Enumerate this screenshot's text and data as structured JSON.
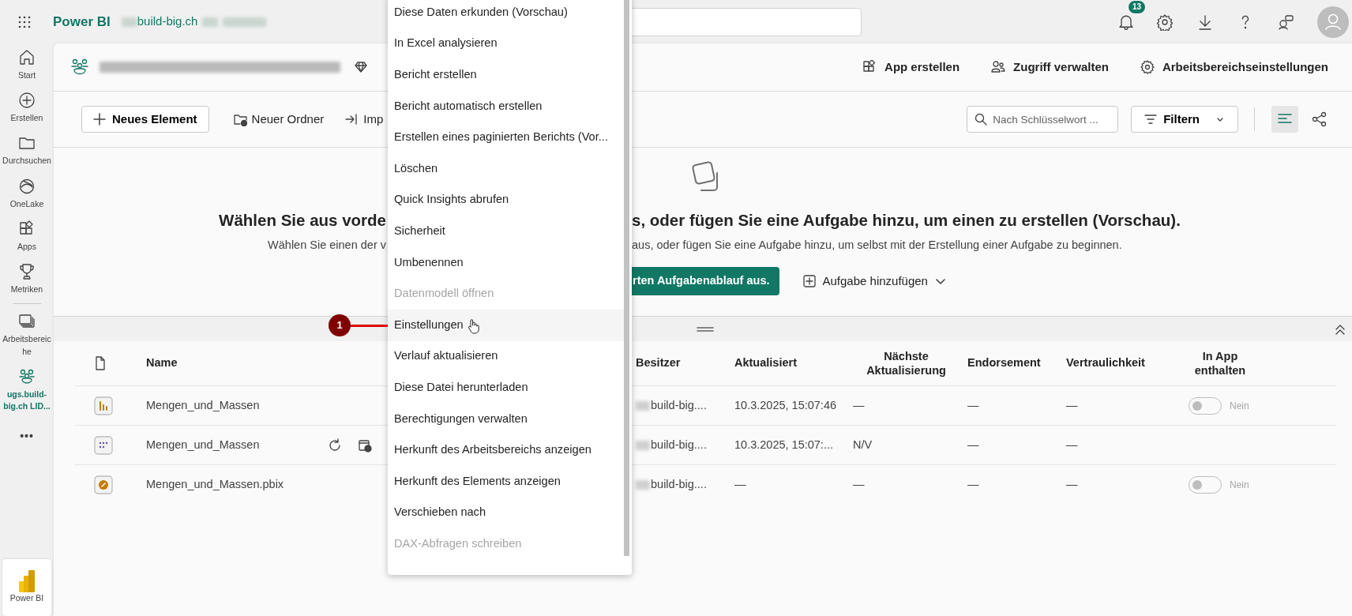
{
  "topbar": {
    "app_name": "Power BI",
    "tenant": "build-big.ch",
    "notification_count": "13"
  },
  "sidebar": {
    "items": [
      {
        "label": "Start",
        "kind": "home",
        "selected": false
      },
      {
        "label": "Erstellen",
        "kind": "create",
        "selected": false
      },
      {
        "label": "Durchsuchen",
        "kind": "browse",
        "selected": false
      },
      {
        "label": "OneLake",
        "kind": "onelake",
        "selected": false
      },
      {
        "label": "Apps",
        "kind": "apps",
        "selected": false
      },
      {
        "label": "Metriken",
        "kind": "metrics",
        "selected": false
      },
      {
        "label": "Arbeitsbereiche",
        "kind": "workspaces",
        "selected": false
      },
      {
        "label": "ugs.build-big.ch LID...",
        "kind": "workspace",
        "selected": true
      }
    ],
    "more": "•••",
    "footer": "Power BI"
  },
  "workspace_header": {
    "actions": [
      {
        "label": "App erstellen",
        "kind": "app"
      },
      {
        "label": "Zugriff verwalten",
        "kind": "access"
      },
      {
        "label": "Arbeitsbereichseinstellungen",
        "kind": "settings"
      }
    ]
  },
  "toolbar": {
    "new_item": "Neues Element",
    "buttons": [
      {
        "label": "Neuer Ordner",
        "kind": "folder"
      },
      {
        "label": "Imp",
        "kind": "import"
      }
    ],
    "search": {
      "placeholder": "Nach Schlüsselwort ..."
    },
    "filter": "Filtern",
    "views": [
      {
        "kind": "list",
        "selected": true
      },
      {
        "kind": "lineage",
        "selected": false
      }
    ]
  },
  "empty_state": {
    "title_parts": [
      "Wählen Sie aus vorde",
      "s, oder fügen Sie eine Aufgabe hinzu, um einen zu erstellen (Vorschau)."
    ],
    "subtitle_parts": [
      "Wählen Sie einen der v",
      "aus, oder fügen Sie eine Aufgabe hinzu, um selbst mit der Erstellung einer Aufgabe zu beginnen."
    ],
    "primary_button": "rten Aufgabenablauf aus.",
    "add_task": "Aufgabe hinzufügen"
  },
  "table": {
    "columns": [
      "Name",
      "Besitzer",
      "Aktualisiert",
      "Nächste Aktualisierung",
      "Endorsement",
      "Vertraulichkeit",
      "In App enthalten"
    ],
    "rows": [
      {
        "kind": "report",
        "name": "Mengen_und_Massen",
        "owner": "build-big....",
        "updated": "10.3.2025, 15:07:46",
        "next_refresh": "—",
        "endorsement": "—",
        "sensitivity": "—",
        "in_app": {
          "on": false,
          "label": "Nein"
        }
      },
      {
        "kind": "semantic_model",
        "name": "Mengen_und_Massen",
        "owner": "build-big....",
        "updated": "10.3.2025, 15:07:...",
        "next_refresh": "N/V",
        "endorsement": "—",
        "sensitivity": "—"
      },
      {
        "kind": "pbix",
        "name": "Mengen_und_Massen.pbix",
        "owner": "build-big....",
        "updated": "—",
        "next_refresh": "—",
        "endorsement": "—",
        "sensitivity": "—",
        "in_app": {
          "on": false,
          "label": "Nein"
        }
      }
    ]
  },
  "context_menu": {
    "items": [
      {
        "label": "Diese Daten erkunden (Vorschau)",
        "disabled": false,
        "hovered": false
      },
      {
        "label": "In Excel analysieren",
        "disabled": false,
        "hovered": false
      },
      {
        "label": "Bericht erstellen",
        "disabled": false,
        "hovered": false
      },
      {
        "label": "Bericht automatisch erstellen",
        "disabled": false,
        "hovered": false
      },
      {
        "label": "Erstellen eines paginierten Berichts (Vor...",
        "disabled": false,
        "hovered": false
      },
      {
        "label": "Löschen",
        "disabled": false,
        "hovered": false
      },
      {
        "label": "Quick Insights abrufen",
        "disabled": false,
        "hovered": false
      },
      {
        "label": "Sicherheit",
        "disabled": false,
        "hovered": false
      },
      {
        "label": "Umbenennen",
        "disabled": false,
        "hovered": false
      },
      {
        "label": "Datenmodell öffnen",
        "disabled": true,
        "hovered": false
      },
      {
        "label": "Einstellungen",
        "disabled": false,
        "hovered": true
      },
      {
        "label": "Verlauf aktualisieren",
        "disabled": false,
        "hovered": false
      },
      {
        "label": "Diese Datei herunterladen",
        "disabled": false,
        "hovered": false
      },
      {
        "label": "Berechtigungen verwalten",
        "disabled": false,
        "hovered": false
      },
      {
        "label": "Herkunft des Arbeitsbereichs anzeigen",
        "disabled": false,
        "hovered": false
      },
      {
        "label": "Herkunft des Elements anzeigen",
        "disabled": false,
        "hovered": false
      },
      {
        "label": "Verschieben nach",
        "disabled": false,
        "hovered": false
      },
      {
        "label": "DAX-Abfragen schreiben",
        "disabled": true,
        "hovered": false
      }
    ]
  },
  "annotation": {
    "label": "1"
  }
}
